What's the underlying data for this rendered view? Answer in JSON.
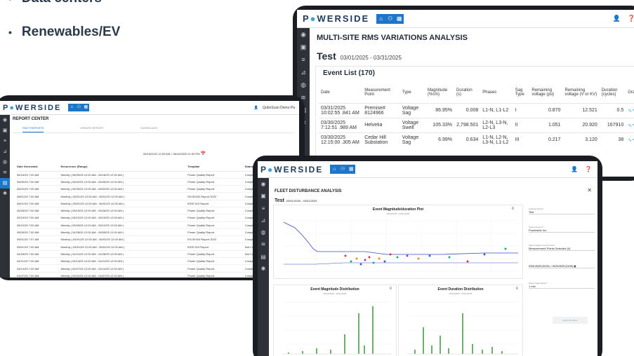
{
  "slide": {
    "bullet1": "Data centers",
    "bullet2": "Renewables/EV"
  },
  "brand": {
    "logo_text_a": "P",
    "logo_text_b": "WERSIDE",
    "accent": "#1d76c9",
    "sidebar_bg": "#2e3138"
  },
  "multi_site": {
    "title": "MULTI-SITE RMS VARIATIONS ANALYSIS",
    "test_label": "Test",
    "date_range": "03/01/2025 - 03/31/2025",
    "event_list": "Event List (170)",
    "columns": [
      "Date",
      "Measurement Point",
      "Type",
      "Magnitude (%Un)",
      "Duration (s)",
      "Phases",
      "Sag Type",
      "Remaining voltage (pu)",
      "Remaining voltage (V or KV)",
      "Duration (cycles)",
      "Graph"
    ],
    "rows": [
      [
        "03/31/2025 10:02:55 .841 AM",
        "Premise# 8124966",
        "Voltage Sag",
        "86.95%",
        "0.008",
        "L1-N, L1-L2",
        "I",
        "0.870",
        "12.521",
        "0.5"
      ],
      [
        "03/30/2025 7:12:51 .989 AM",
        "Helvetia",
        "Voltage Swell",
        "105.33%",
        "2,798.501",
        "L2-N, L3-N, L2-L3",
        "II",
        "1.051",
        "20.920",
        "167910"
      ],
      [
        "03/30/2025 12:15:00 .305 AM",
        "Cedar Hill Substation",
        "Voltage Sag",
        "6.99%",
        "0.634",
        "L1-N, L2-N, L3-N, L1-L2",
        "III",
        "0.217",
        "3.120",
        "38"
      ]
    ]
  },
  "report_center": {
    "title": "REPORT CENTER",
    "tabs": [
      "PAST REPORTS",
      "CREATE REPORT",
      "SCHEDULES"
    ],
    "user": "QuboScan Demo Pa",
    "range": "05/16/2024 12:00 AM > 06/16/2025 11:59 PM",
    "columns": [
      "Date Generated",
      "Recurrence (Range)",
      "Template",
      "Status",
      "Inform"
    ],
    "rows": [
      [
        "06/16/25 7:00 AM",
        "Weekly ( 06/09/25 12:00 AM - 06/16/25 12:00 AM )",
        "Power Quality Report",
        "Compliant",
        "PQ O"
      ],
      [
        "06/09/25 7:00 AM",
        "Weekly ( 06/02/25 12:00 AM - 06/09/25 12:00 AM )",
        "Power Quality Report",
        "Compliant",
        "PQ O"
      ],
      [
        "06/02/25 7:00 AM",
        "Weekly ( 05/26/25 12:00 AM - 06/02/25 12:00 AM )",
        "Power Quality Report",
        "Compliant",
        "PQ O"
      ],
      [
        "06/01/25 7:00 AM",
        "Monthly ( 05/01/25 12:00 AM - 06/01/25 12:00 AM )",
        "EN 50160 Report 2022",
        "Compliant",
        "ENBI"
      ],
      [
        "06/01/25 7:00 AM",
        "Monthly ( 05/01/25 12:00 AM - 06/01/25 12:00 AM )",
        "IEEE 519 Report",
        "Compliant",
        "Month"
      ],
      [
        "05/26/25 7:00 AM",
        "Weekly ( 05/19/25 12:00 AM - 05/26/25 12:00 AM )",
        "Power Quality Report",
        "Compliant",
        "PQ O"
      ],
      [
        "05/19/25 7:00 AM",
        "Weekly ( 05/12/25 12:00 AM - 05/19/25 12:00 AM )",
        "Power Quality Report",
        "Compliant",
        "PQ O"
      ],
      [
        "05/12/25 7:00 AM",
        "Weekly ( 05/05/25 12:00 AM - 05/12/25 12:00 AM )",
        "Power Quality Report",
        "Compliant",
        "PQ O"
      ],
      [
        "05/05/25 7:00 AM",
        "Weekly ( 04/28/25 12:00 AM - 05/05/25 12:00 AM )",
        "Power Quality Report",
        "Compliant",
        "PQ O"
      ],
      [
        "05/01/25 7:07 AM",
        "Monthly ( 04/01/25 12:00 AM - 05/01/25 12:00 AM )",
        "EN 50160 Report 2022",
        "Compliant",
        "ENBI"
      ],
      [
        "05/01/25 7:00 AM",
        "Monthly ( 04/01/25 12:00 AM - 05/01/25 12:00 AM )",
        "IEEE 519 Report",
        "Not Compliant",
        "Month"
      ],
      [
        "04/28/25 7:00 AM",
        "Weekly ( 04/21/25 12:00 AM - 04/28/25 12:00 AM )",
        "Power Quality Report",
        "Not Compliant",
        "PQ O"
      ],
      [
        "04/21/25 7:00 AM",
        "Weekly ( 04/14/25 12:00 AM - 04/21/25 12:00 AM )",
        "Power Quality Report",
        "Compliant",
        "PQ O"
      ],
      [
        "04/14/25 7:00 AM",
        "Weekly ( 04/07/25 12:00 AM - 04/14/25 12:00 AM )",
        "Power Quality Report",
        "Compliant",
        "PQ O"
      ],
      [
        "04/07/25 7:00 AM",
        "Weekly ( 03/31/25 12:00 AM - 04/07/25 12:00 AM )",
        "Power Quality Report",
        "Compliant",
        "PQ O"
      ]
    ]
  },
  "fleet": {
    "title": "FLEET DISTURBANCE ANALYSIS",
    "test_label": "Test",
    "date_range": "03/01/2025 - 03/31/2025",
    "plot1_title": "Event Magnitude/duration Plot",
    "plot1_sub": "03/01/2025 - 03/31/2025",
    "plot2_title": "Event Magnitude Distribution",
    "plot2_sub": "03/01/2025 - 03/31/2025",
    "plot3_title": "Event Duration Distribution",
    "plot3_sub": "03/01/2025 - 03/31/2025",
    "panel": {
      "analysis_name_label": "Analysis Name*",
      "analysis_name_value": "Test",
      "account_label": "Select Account*",
      "account_value": "Powerside Inc.",
      "mp_label": "Select Measurement Points*",
      "mp_value": "Measurement Points Selected (0)",
      "date_from": "03/01/2025 (00:00)",
      "date_to": "> 03/31/2025 (23:59)",
      "agg_label": "Select Aggregation*",
      "agg_value": "1 min",
      "apply_label": "Apply and Save"
    }
  }
}
